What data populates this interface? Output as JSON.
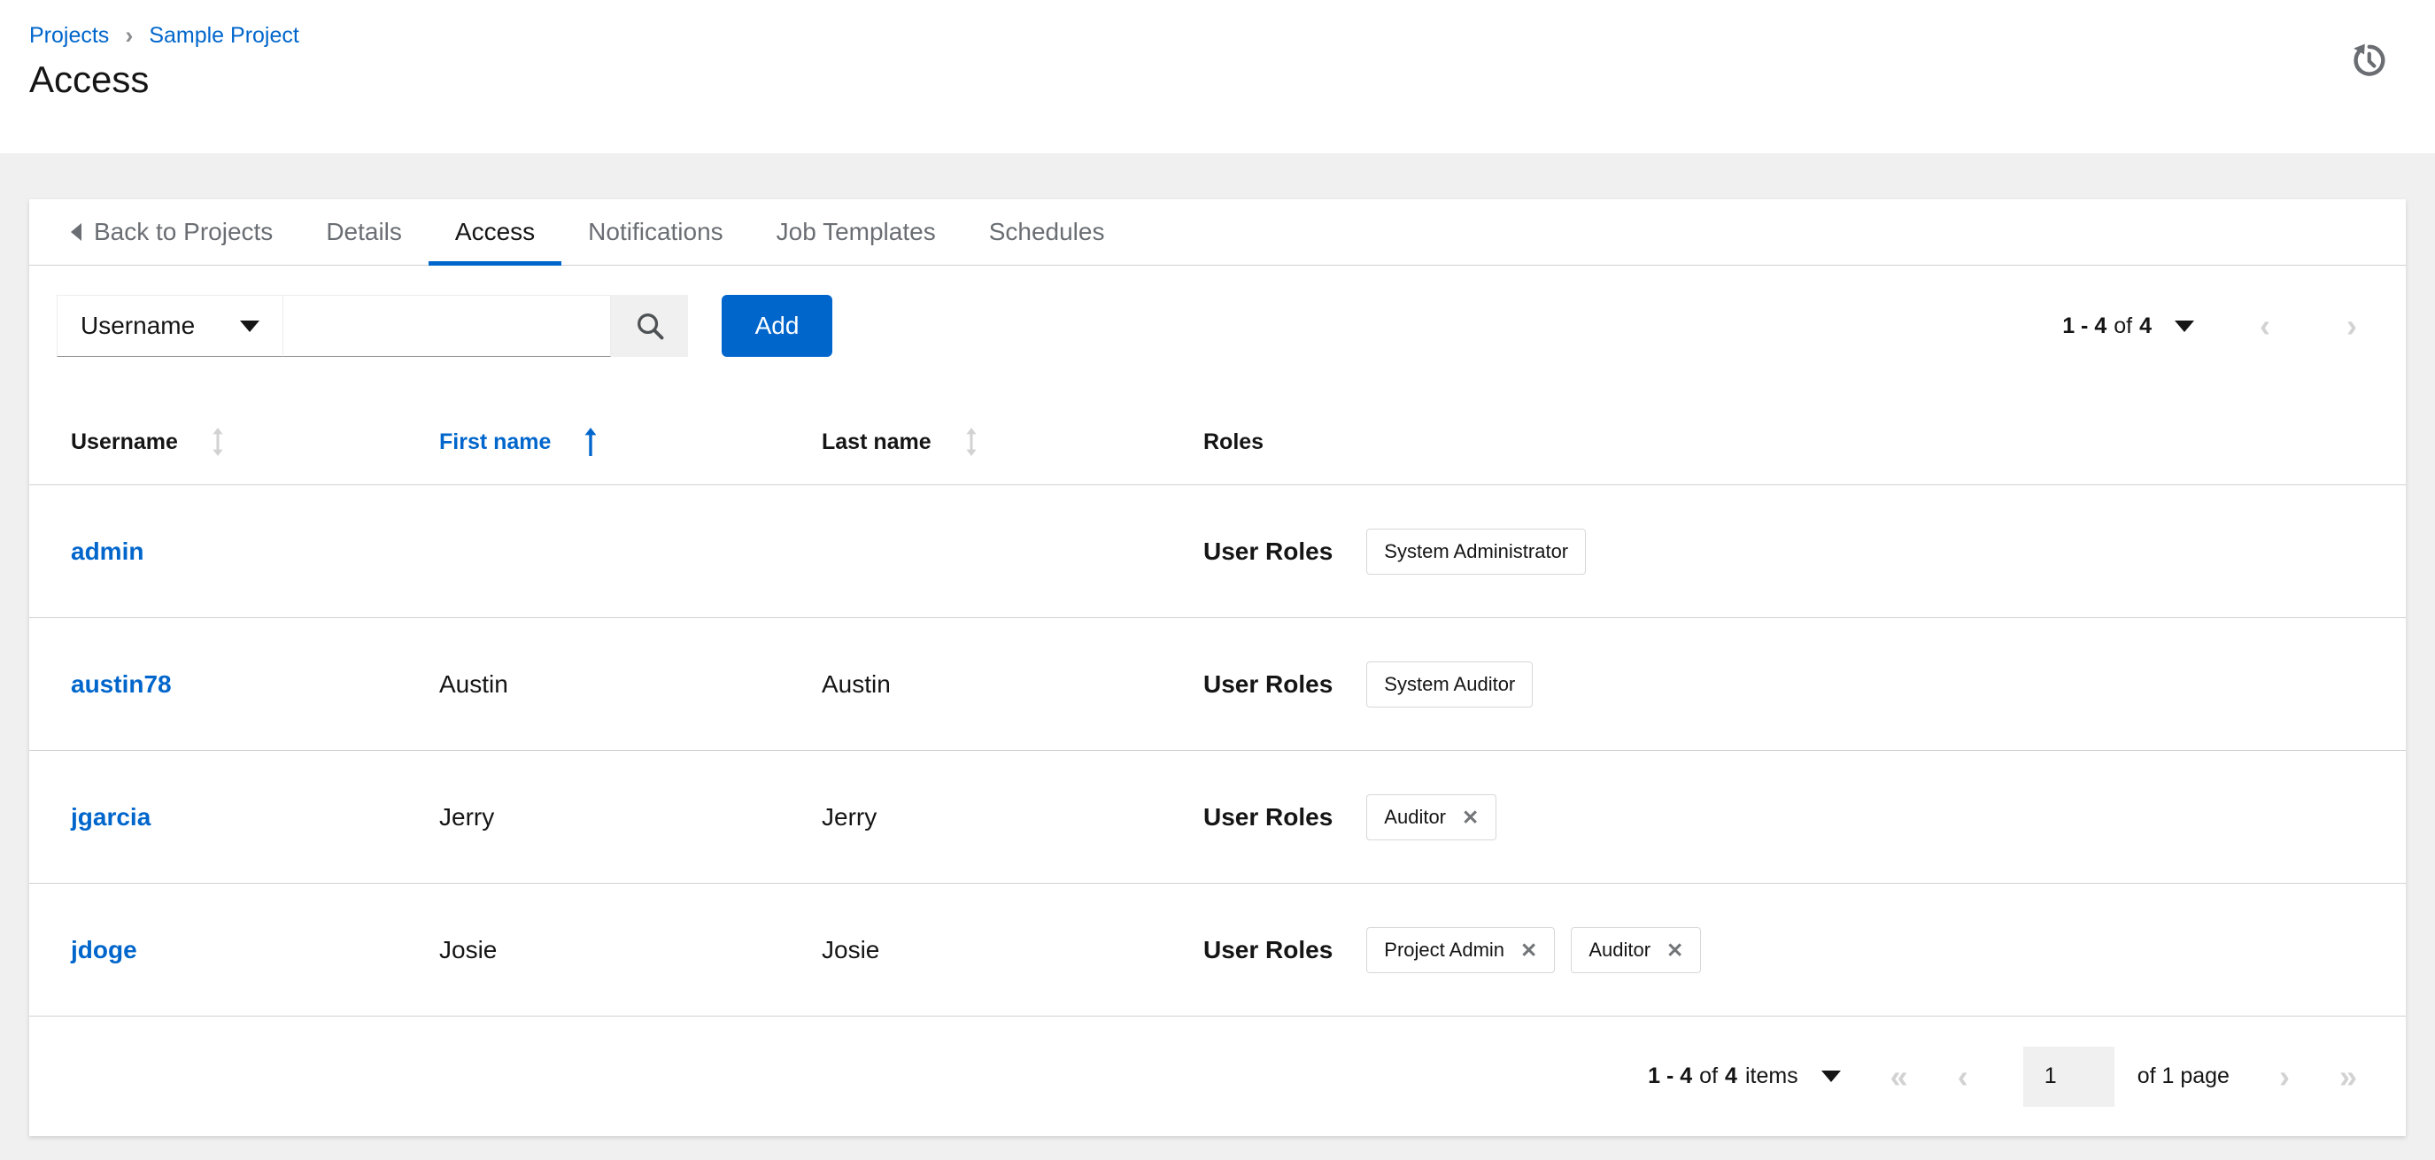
{
  "colors": {
    "accent_blue": "#0066cc",
    "link_blue": "#0066cc",
    "text_primary": "#151515",
    "text_secondary": "#6a6e73",
    "border": "#d2d2d2",
    "disabled_arrow": "#d2d2d2",
    "background": "#f0f0f0"
  },
  "page": {
    "breadcrumb": [
      "Projects",
      "Sample Project"
    ],
    "title": "Access"
  },
  "icons": {
    "breadcrumb_separator": "›",
    "chip_close": "✕",
    "first_page": "«",
    "prev_page": "‹",
    "next_page": "›",
    "last_page": "»"
  },
  "tabs": [
    {
      "label": "Back to Projects"
    },
    {
      "label": "Details"
    },
    {
      "label": "Access",
      "active": true
    },
    {
      "label": "Notifications"
    },
    {
      "label": "Job Templates"
    },
    {
      "label": "Schedules"
    }
  ],
  "toolbar": {
    "filter_select": {
      "value": "Username"
    },
    "search": {
      "value": "",
      "placeholder": ""
    },
    "add_label": "Add",
    "pagination": {
      "range": "1 - 4",
      "of": "of",
      "total": "4"
    }
  },
  "table": {
    "columns": [
      {
        "label": "Username",
        "sort": "inactive"
      },
      {
        "label": "First name",
        "sort": "ascending"
      },
      {
        "label": "Last name",
        "sort": "inactive"
      },
      {
        "label": "Roles",
        "sort": "none"
      }
    ],
    "rows": [
      {
        "username": "admin",
        "first_name": "",
        "last_name": "",
        "roles_label": "User Roles",
        "chips": [
          {
            "label": "System Administrator",
            "removable": false
          }
        ]
      },
      {
        "username": "austin78",
        "first_name": "Austin",
        "last_name": "Austin",
        "roles_label": "User Roles",
        "chips": [
          {
            "label": "System Auditor",
            "removable": false
          }
        ]
      },
      {
        "username": "jgarcia",
        "first_name": "Jerry",
        "last_name": "Jerry",
        "roles_label": "User Roles",
        "chips": [
          {
            "label": "Auditor",
            "removable": true
          }
        ]
      },
      {
        "username": "jdoge",
        "first_name": "Josie",
        "last_name": "Josie",
        "roles_label": "User Roles",
        "chips": [
          {
            "label": "Project Admin",
            "removable": true
          },
          {
            "label": "Auditor",
            "removable": true
          }
        ]
      }
    ]
  },
  "footer_pagination": {
    "range": "1 - 4",
    "of": "of",
    "total": "4",
    "suffix": "items",
    "page_value": "1",
    "page_of": "of 1 page"
  }
}
